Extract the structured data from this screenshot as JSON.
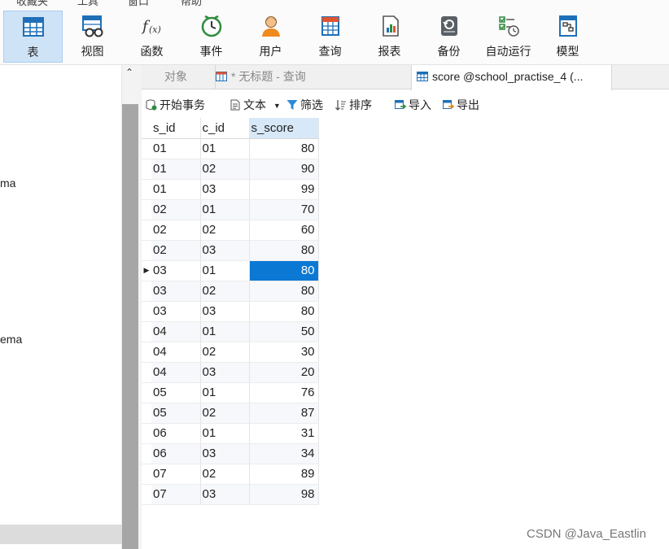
{
  "menu": {
    "items": [
      "收藏夹",
      "工具",
      "窗口",
      "帮助"
    ]
  },
  "toolbar": {
    "items": [
      {
        "label": "表",
        "icon": "table-icon"
      },
      {
        "label": "视图",
        "icon": "view-icon"
      },
      {
        "label": "函数",
        "icon": "function-icon"
      },
      {
        "label": "事件",
        "icon": "event-clock-icon"
      },
      {
        "label": "用户",
        "icon": "user-icon"
      },
      {
        "label": "查询",
        "icon": "query-icon"
      },
      {
        "label": "报表",
        "icon": "report-icon"
      },
      {
        "label": "备份",
        "icon": "backup-icon"
      },
      {
        "label": "自动运行",
        "icon": "autorun-icon"
      },
      {
        "label": "模型",
        "icon": "model-icon"
      }
    ],
    "active_index": 0
  },
  "navigator": {
    "items": [
      "ma",
      "ema"
    ]
  },
  "tabs": {
    "objects": "对象",
    "query": "* 无标题 - 查询",
    "table": "score @school_practise_4 (..."
  },
  "data_toolbar": {
    "begin_transaction": "开始事务",
    "text": "文本",
    "filter": "筛选",
    "sort": "排序",
    "import": "导入",
    "export": "导出"
  },
  "grid": {
    "columns": [
      "s_id",
      "c_id",
      "s_score"
    ],
    "rows": [
      [
        "01",
        "01",
        "80"
      ],
      [
        "01",
        "02",
        "90"
      ],
      [
        "01",
        "03",
        "99"
      ],
      [
        "02",
        "01",
        "70"
      ],
      [
        "02",
        "02",
        "60"
      ],
      [
        "02",
        "03",
        "80"
      ],
      [
        "03",
        "01",
        "80"
      ],
      [
        "03",
        "02",
        "80"
      ],
      [
        "03",
        "03",
        "80"
      ],
      [
        "04",
        "01",
        "50"
      ],
      [
        "04",
        "02",
        "30"
      ],
      [
        "04",
        "03",
        "20"
      ],
      [
        "05",
        "01",
        "76"
      ],
      [
        "05",
        "02",
        "87"
      ],
      [
        "06",
        "01",
        "31"
      ],
      [
        "06",
        "03",
        "34"
      ],
      [
        "07",
        "02",
        "89"
      ],
      [
        "07",
        "03",
        "98"
      ]
    ],
    "current_row": 6,
    "selected_column": 2
  },
  "watermark": "CSDN @Java_Eastlin",
  "colors": {
    "selection": "#0b78d4",
    "toolbar_active": "#cfe3f7",
    "header_selected": "#d7e8f8"
  }
}
